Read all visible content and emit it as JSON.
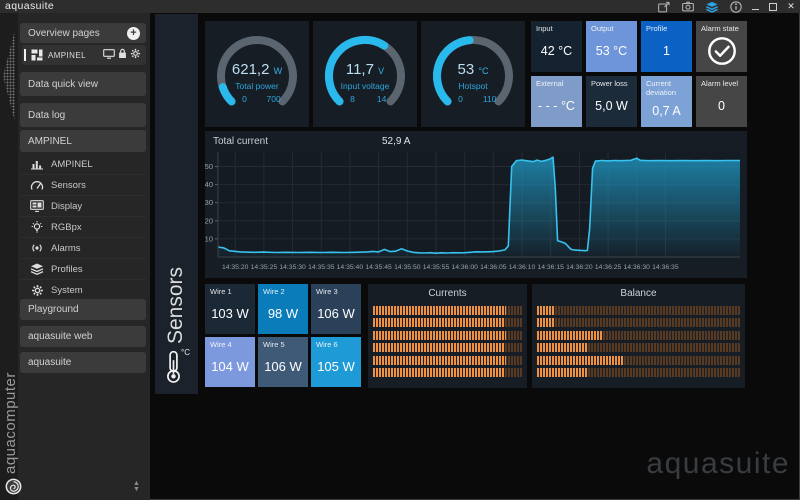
{
  "titlebar": {
    "title": "aquasuite",
    "icons": [
      "export-page-icon",
      "screenshot-icon",
      "profiles-layers-icon",
      "info-icon"
    ]
  },
  "sidebar": {
    "overview_header": {
      "label": "Overview pages",
      "plus_glyph": "+"
    },
    "overview_item": {
      "label": "AMPINEL",
      "icons": [
        "dashboard-grid-icon",
        "monitor-icon",
        "lock-icon",
        "gear-icon"
      ]
    },
    "quick_view_label": "Data quick view",
    "data_log_label": "Data log",
    "device_header_label": "AMPINEL",
    "device_items": [
      {
        "label": "AMPINEL",
        "icon": "bar-chart-icon"
      },
      {
        "label": "Sensors",
        "icon": "speedometer-icon"
      },
      {
        "label": "Display",
        "icon": "display-icon"
      },
      {
        "label": "RGBpx",
        "icon": "bulb-icon"
      },
      {
        "label": "Alarms",
        "icon": "alarm-icon"
      },
      {
        "label": "Profiles",
        "icon": "layers-icon"
      },
      {
        "label": "System",
        "icon": "gear-icon"
      }
    ],
    "bottom_items": [
      "Playground",
      "aquasuite web",
      "aquasuite"
    ],
    "brand_vertical": "aquacomputer",
    "scroll_up_glyph": "▲",
    "scroll_down_glyph": "▼"
  },
  "page_tab": {
    "label": "Sensors",
    "unit": "°C",
    "icon": "thermometer-icon"
  },
  "gauges": [
    {
      "value": "621,2",
      "unit": "W",
      "label": "Total power",
      "min": "0",
      "max": "700",
      "fraction": 0.1
    },
    {
      "value": "11,7",
      "unit": "V",
      "label": "Input voltage",
      "min": "8",
      "max": "14",
      "fraction": 0.62
    },
    {
      "value": "53",
      "unit": "°C",
      "label": "Hotspot",
      "min": "0",
      "max": "110",
      "fraction": 0.48
    }
  ],
  "tiles": [
    {
      "label": "Input",
      "value": "42 °C",
      "bg": "#152330"
    },
    {
      "label": "Output",
      "value": "53 °C",
      "bg": "#6e95d9"
    },
    {
      "label": "Profile",
      "value": "1",
      "bg": "#0b62c4"
    },
    {
      "label": "Alarm state",
      "value": "",
      "bg": "#464646",
      "icon": "check-circle-icon"
    },
    {
      "label": "External",
      "value": "- - - °C",
      "bg": "#7f9cc9"
    },
    {
      "label": "Power loss",
      "value": "5,0 W",
      "bg": "#1b2b3a"
    },
    {
      "label": "Current deviation",
      "value": "0,7 A",
      "bg": "#7da2d6"
    },
    {
      "label": "Alarm level",
      "value": "0",
      "bg": "#464646"
    }
  ],
  "chart_data": {
    "type": "area",
    "title": "Total current",
    "current_value": "52,9 A",
    "unit": "A",
    "line_color": "#38c2f0",
    "fill_color": "#2095c0",
    "ylim": [
      0,
      58
    ],
    "y_ticks": [
      10,
      20,
      30,
      40,
      50
    ],
    "x_tick_labels": [
      "14:35:20",
      "14:35:25",
      "14:35:30",
      "14:35:35",
      "14:35:40",
      "14:35:45",
      "14:35:50",
      "14:35:55",
      "14:36:00",
      "14:36:05",
      "14:36:10",
      "14:36:15",
      "14:36:20",
      "14:36:25",
      "14:36:30",
      "14:36:35"
    ],
    "x_tick_seconds": [
      3,
      8,
      13,
      18,
      23,
      28,
      33,
      38,
      43,
      48,
      53,
      58,
      63,
      68,
      73,
      78
    ],
    "xlim_seconds": [
      0,
      91
    ],
    "grid": true,
    "points": [
      [
        0,
        5.5
      ],
      [
        1,
        5.0
      ],
      [
        2,
        3.4
      ],
      [
        4,
        2.8
      ],
      [
        6,
        2.6
      ],
      [
        8,
        2.7
      ],
      [
        10,
        2.5
      ],
      [
        12,
        2.6
      ],
      [
        14,
        2.5
      ],
      [
        16,
        2.6
      ],
      [
        18,
        2.5
      ],
      [
        20,
        2.6
      ],
      [
        22,
        2.5
      ],
      [
        24,
        2.6
      ],
      [
        26,
        2.8
      ],
      [
        27,
        3.1
      ],
      [
        28,
        2.8
      ],
      [
        29,
        4.2
      ],
      [
        30,
        3.0
      ],
      [
        31,
        3.2
      ],
      [
        32,
        4.6
      ],
      [
        33,
        3.3
      ],
      [
        34,
        2.6
      ],
      [
        35,
        2.3
      ],
      [
        36,
        2.2
      ],
      [
        37,
        2.4
      ],
      [
        38,
        2.1
      ],
      [
        39,
        2.3
      ],
      [
        40,
        2.2
      ],
      [
        41,
        2.4
      ],
      [
        42,
        2.3
      ],
      [
        43,
        2.4
      ],
      [
        44,
        2.6
      ],
      [
        45,
        2.9
      ],
      [
        46,
        2.8
      ],
      [
        47,
        2.9
      ],
      [
        48,
        3.0
      ],
      [
        49,
        3.3
      ],
      [
        50,
        3.9
      ],
      [
        50.6,
        6.0
      ],
      [
        51.2,
        50.0
      ],
      [
        52,
        53.2
      ],
      [
        53,
        53.6
      ],
      [
        54,
        53.1
      ],
      [
        55,
        52.7
      ],
      [
        55.6,
        53.5
      ],
      [
        56.4,
        52.8
      ],
      [
        57.2,
        53.4
      ],
      [
        58,
        54.3
      ],
      [
        58.4,
        55.2
      ],
      [
        58.8,
        38.0
      ],
      [
        59.2,
        9.0
      ],
      [
        59.8,
        8.4
      ],
      [
        60.5,
        7.6
      ],
      [
        61,
        6.0
      ],
      [
        61.5,
        4.3
      ],
      [
        62,
        3.9
      ],
      [
        63,
        3.7
      ],
      [
        64,
        3.5
      ],
      [
        64.4,
        3.6
      ],
      [
        64.8,
        16.0
      ],
      [
        65.3,
        49.0
      ],
      [
        65.8,
        53.0
      ],
      [
        67,
        53.3
      ],
      [
        68,
        53.1
      ],
      [
        69,
        53.3
      ],
      [
        70,
        53.2
      ],
      [
        71,
        53.3
      ],
      [
        72,
        53.4
      ],
      [
        73,
        54.6
      ],
      [
        73.6,
        53.4
      ],
      [
        75,
        53.2
      ],
      [
        77,
        53.3
      ],
      [
        79,
        53.2
      ],
      [
        81,
        53.3
      ],
      [
        83,
        53.2
      ],
      [
        85,
        53.3
      ],
      [
        87,
        53.2
      ],
      [
        89,
        53.3
      ],
      [
        91,
        53.3
      ]
    ]
  },
  "wires": [
    {
      "label": "Wire 1",
      "value": "103 W",
      "bg": "#1b2836"
    },
    {
      "label": "Wire 2",
      "value": "98 W",
      "bg": "#0a7cba"
    },
    {
      "label": "Wire 3",
      "value": "106 W",
      "bg": "#2b4159"
    },
    {
      "label": "Wire 4",
      "value": "104 W",
      "bg": "#7d99de"
    },
    {
      "label": "Wire 5",
      "value": "106 W",
      "bg": "#3f5a77"
    },
    {
      "label": "Wire 6",
      "value": "105 W",
      "bg": "#1e9ad6"
    }
  ],
  "bar_panels": [
    {
      "title": "Currents",
      "fills": [
        0.89,
        0.88,
        0.89,
        0.88,
        0.89,
        0.88
      ]
    },
    {
      "title": "Balance",
      "fills": [
        0.085,
        0.09,
        0.325,
        0.25,
        0.43,
        0.25
      ]
    }
  ],
  "watermark": "aquasuite",
  "colors": {
    "accent_cyan": "#29b9ec",
    "gauge_track": "#5b6570",
    "bar_orange": "#ef9140",
    "bar_orange_dim": "#59391f",
    "panel_bg": "#161d25",
    "tab_bg": "#1b222b",
    "titlebar_bg": "#2d2d2d",
    "sidebar_bg": "#262626"
  }
}
